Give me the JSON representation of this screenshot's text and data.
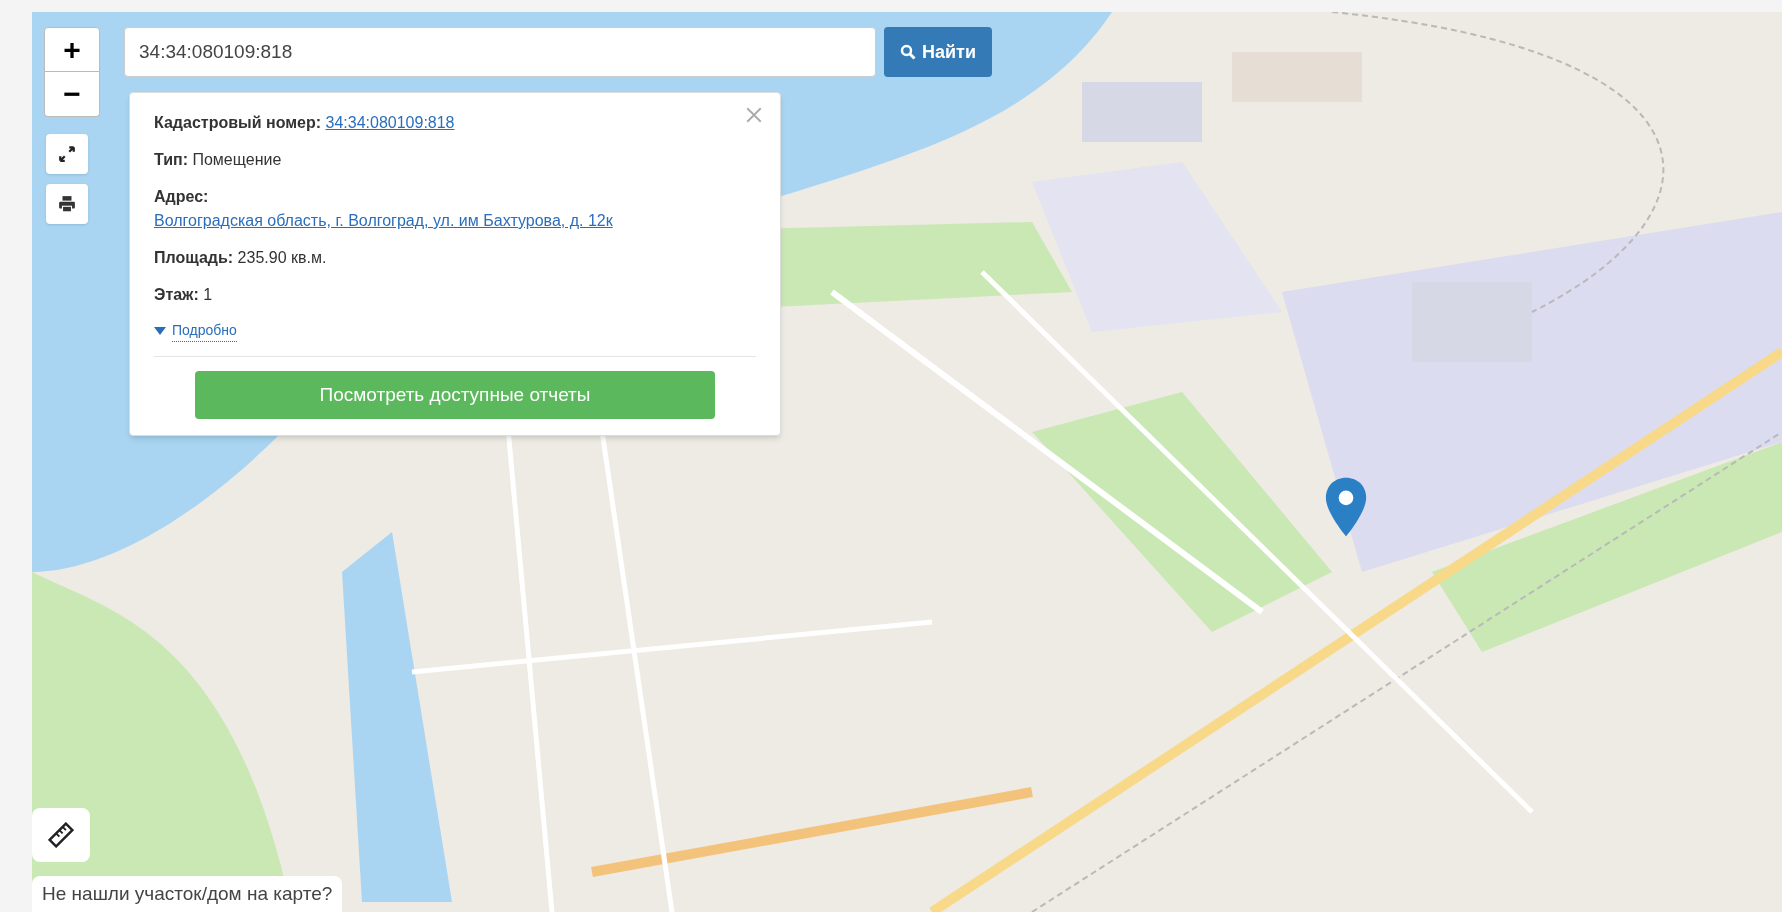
{
  "search": {
    "value": "34:34:080109:818",
    "button": "Найти"
  },
  "zoom": {
    "in": "+",
    "out": "−"
  },
  "popup": {
    "fields": [
      {
        "label": "Кадастровый номер:",
        "value": "34:34:080109:818",
        "kind": "link"
      },
      {
        "label": "Тип:",
        "value": "Помещение",
        "kind": "text"
      },
      {
        "label": "Адрес:",
        "value": "Волгоградская область, г. Волгоград, ул. им Бахтурова, д. 12к",
        "kind": "link"
      },
      {
        "label": "Площадь:",
        "value": "235.90 кв.м.",
        "kind": "text"
      },
      {
        "label": "Этаж:",
        "value": "1",
        "kind": "text"
      }
    ],
    "details": {
      "label": "Подробно",
      "expanded": false
    },
    "action": "Посмотреть доступные отчеты"
  },
  "help_link": "Не нашли участок/дом на карте?"
}
